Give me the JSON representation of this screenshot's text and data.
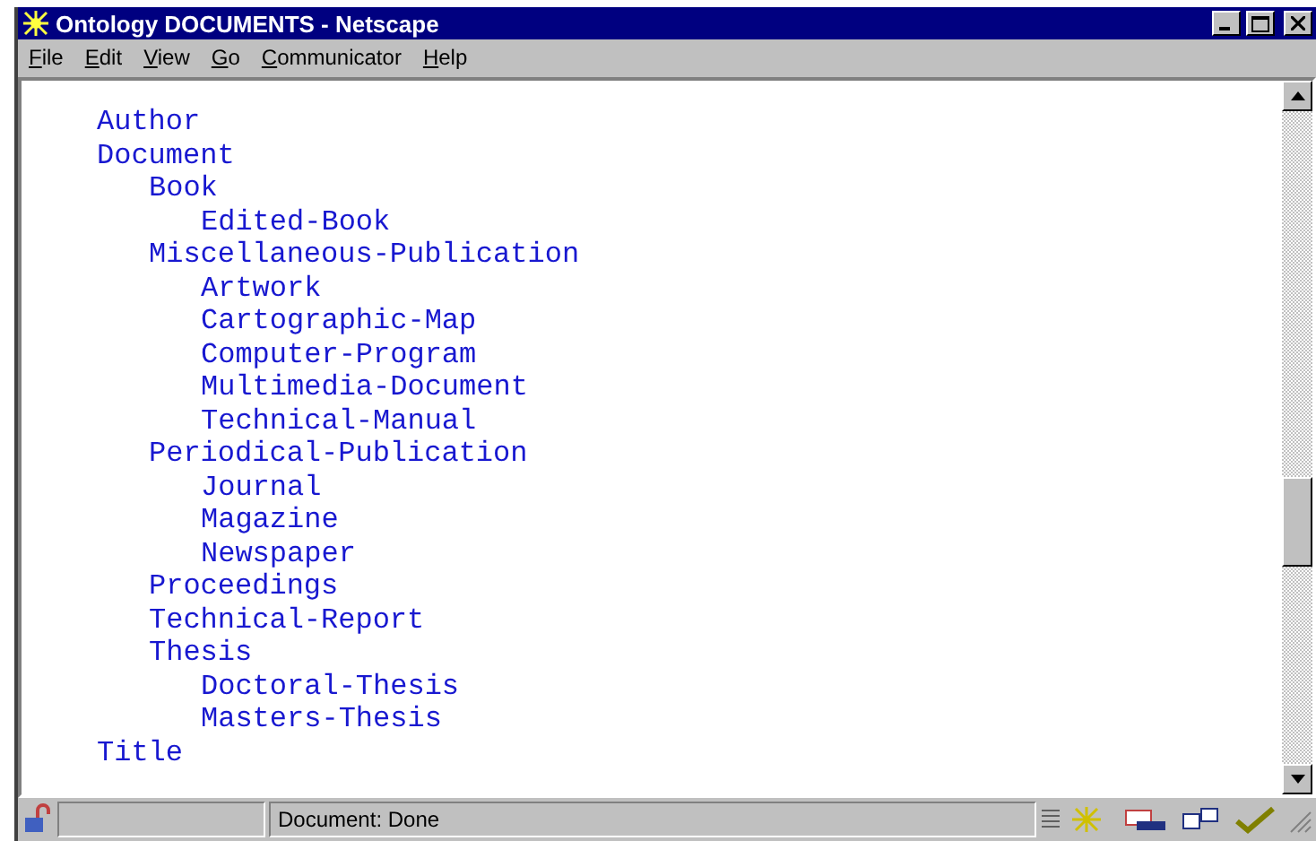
{
  "window": {
    "title": "Ontology DOCUMENTS - Netscape"
  },
  "menu": [
    "File",
    "Edit",
    "View",
    "Go",
    "Communicator",
    "Help"
  ],
  "tree": [
    {
      "label": "Author"
    },
    {
      "label": "Document",
      "children": [
        {
          "label": "Book",
          "children": [
            {
              "label": "Edited-Book"
            }
          ]
        },
        {
          "label": "Miscellaneous-Publication",
          "children": [
            {
              "label": "Artwork"
            },
            {
              "label": "Cartographic-Map"
            },
            {
              "label": "Computer-Program"
            },
            {
              "label": "Multimedia-Document"
            },
            {
              "label": "Technical-Manual"
            }
          ]
        },
        {
          "label": "Periodical-Publication",
          "children": [
            {
              "label": "Journal"
            },
            {
              "label": "Magazine"
            },
            {
              "label": "Newspaper"
            }
          ]
        },
        {
          "label": "Proceedings"
        },
        {
          "label": "Technical-Report"
        },
        {
          "label": "Thesis",
          "children": [
            {
              "label": "Doctoral-Thesis"
            },
            {
              "label": "Masters-Thesis"
            }
          ]
        }
      ]
    },
    {
      "label": "Title"
    }
  ],
  "status_bar": {
    "message": "Document: Done"
  }
}
